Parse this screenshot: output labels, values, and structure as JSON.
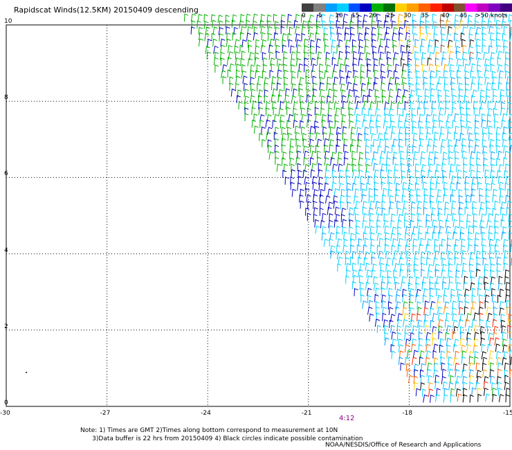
{
  "title": "Rapidscat Winds(12.5KM) 20150409 descending",
  "legend": {
    "colors": [
      "#404040",
      "#808080",
      "#00a0ff",
      "#00d0ff",
      "#0050ff",
      "#0000c0",
      "#00b000",
      "#007000",
      "#ffd000",
      "#ffa000",
      "#ff6000",
      "#ff2000",
      "#c00000",
      "#805030",
      "#ff00ff",
      "#c000c0",
      "#8000c0",
      "#400080"
    ],
    "labels": [
      "0",
      "5",
      "10",
      "15",
      "20",
      "25",
      "30",
      "35",
      "40",
      "45",
      ">50 knots"
    ]
  },
  "chart_data": {
    "type": "map",
    "title": "Rapidscat Winds(12.5KM) 20150409 descending",
    "x_ticks": [
      "-30",
      "-27",
      "-24",
      "-21",
      "-18",
      "-15"
    ],
    "y_ticks": [
      "0",
      "2",
      "4",
      "6",
      "8",
      "10"
    ],
    "xlim": [
      -30,
      -15
    ],
    "ylim": [
      0,
      10
    ],
    "grid": true,
    "pass_time_label": "4:12"
  },
  "notes": [
    "Note: 1) Times are GMT 2)Times along bottom correspond to measurement at 10N",
    "      3)Data buffer is 22 hrs from 20150409 4) Black circles indicate possible contamination"
  ],
  "credit": "NOAA/NESDIS/Office of Research and Applications"
}
